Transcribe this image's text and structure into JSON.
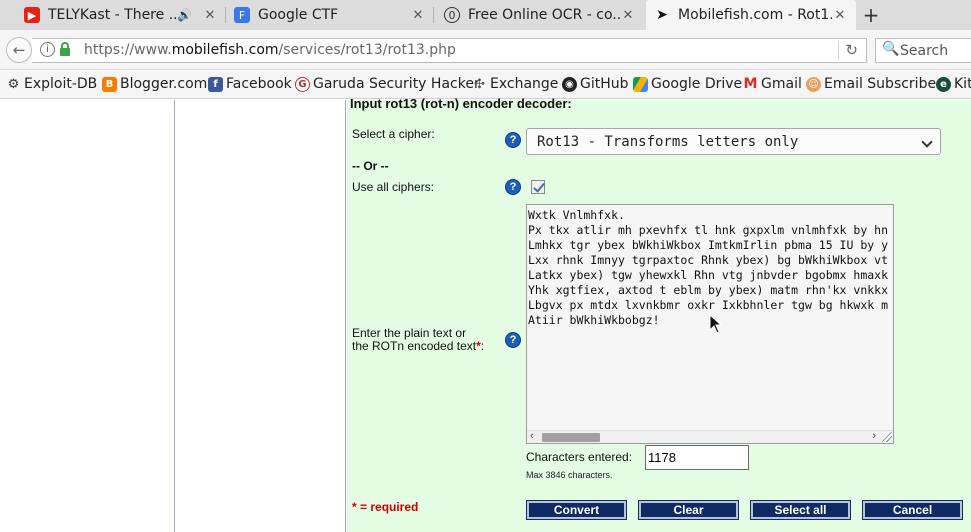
{
  "tabs": [
    {
      "title": "TELYKast - There ...",
      "favicon": "youtube-icon",
      "audio": true
    },
    {
      "title": "Google CTF",
      "favicon": "shield-icon"
    },
    {
      "title": "Free Online OCR - co...",
      "favicon": "ocr-icon"
    },
    {
      "title": "Mobilefish.com - Rot1...",
      "favicon": "fish-icon",
      "active": true
    }
  ],
  "address": {
    "url_prefix": "https://www.",
    "url_domain": "mobilefish.com",
    "url_path": "/services/rot13/rot13.php"
  },
  "search": {
    "placeholder": "Search"
  },
  "bookmarks": [
    "Exploit-DB",
    "Blogger.com",
    "Facebook",
    "Garuda Security Hacker",
    "Exchange",
    "GitHub",
    "Google Drive",
    "Gmail",
    "Email Subscriber",
    "Kit"
  ],
  "form": {
    "heading": "Input rot13 (rot-n) encoder decoder:",
    "cipher_label": "Select a cipher:",
    "cipher_value": "Rot13 - Transforms letters only",
    "or_label": "-- Or --",
    "all_ciphers_label": "Use all ciphers:",
    "text_label_line1": "Enter the plain text or",
    "text_label_line2": "the ROTn encoded text",
    "required_mark": "*",
    "text_lines": [
      "Wxtk Vnlmhfxk.",
      "Px tkx atlir mh pxevhfx tl hnk gxpxlm vnlmhfxk by hn",
      "Lmhkx tgr ybex bWkhiWkbox ImtkmIrlin pbma 15 IU by y",
      "Lxx rhnk Imnyy tgrpaxtoc Rhnk ybex) bg bWkhiWkbox vt",
      "Latkx ybex) tgw yhewxkl Rhn vtg jnbvder bgobmx hmaxk",
      "Yhk xgtfiex, axtod t eblm by ybex) matm rhn'kx vnkkx",
      "Lbgvx px mtdx lxvnkbmr oxkr Ixkbhnler tgw bg hkwxk m",
      "Atiir bWkhiWkbobgz!"
    ],
    "chars_label": "Characters entered:",
    "chars_value": "1178",
    "max_note": "Max 3846 characters.",
    "required_note": "* = required"
  },
  "buttons": {
    "convert": "Convert",
    "clear": "Clear",
    "select_all": "Select all",
    "cancel": "Cancel"
  },
  "colors": {
    "panel_bg": "#e3fce3",
    "button_bg": "#0f2a64",
    "help_icon": "#1d5fb8",
    "required": "#d10000"
  }
}
